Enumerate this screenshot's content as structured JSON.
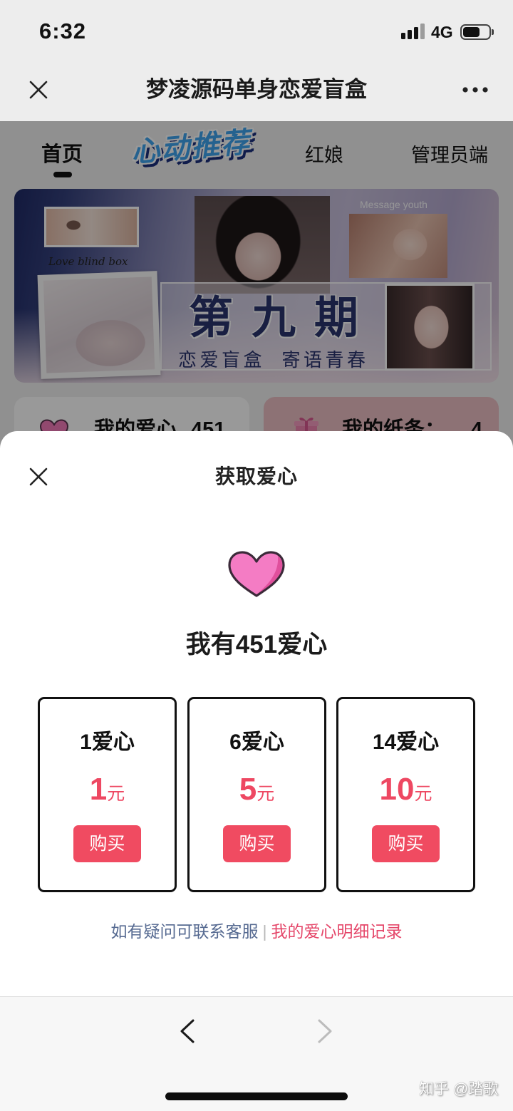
{
  "status_bar": {
    "time": "6:32",
    "network": "4G",
    "signal_bars": 3,
    "signal_max": 4,
    "battery_level": 0.65
  },
  "nav_bar": {
    "title": "梦凌源码单身恋爱盲盒",
    "close_icon": "close-icon",
    "more_icon": "more-dots-icon"
  },
  "page": {
    "tabs": [
      {
        "label": "首页",
        "active": true
      },
      {
        "label": "心动推荐",
        "active": false
      },
      {
        "label": "红娘",
        "active": false
      },
      {
        "label": "管理员端",
        "active": false
      }
    ],
    "banner": {
      "caption_left": "Love blind box",
      "caption_right": "Message youth",
      "issue": "第九期",
      "subtitle": "恋爱盲盒  寄语青春"
    },
    "stats": [
      {
        "icon": "heart-icon",
        "label": "我的爱心",
        "value": "451"
      },
      {
        "icon": "gift-icon",
        "label": "我的纸条：",
        "value": "4"
      }
    ]
  },
  "modal": {
    "title": "获取爱心",
    "close_icon": "close-icon",
    "heart_icon": "heart-icon",
    "balance": {
      "prefix": "我有",
      "value": "451",
      "suffix": "爱心"
    },
    "packages": [
      {
        "label": "1爱心",
        "price": "1",
        "currency": "元",
        "button": "购买"
      },
      {
        "label": "6爱心",
        "price": "5",
        "currency": "元",
        "button": "购买"
      },
      {
        "label": "14爱心",
        "price": "10",
        "currency": "元",
        "button": "购买"
      }
    ],
    "footer": {
      "contact": "如有疑问可联系客服",
      "separator": "|",
      "records": "我的爱心明细记录"
    }
  },
  "browser_bar": {
    "back_icon": "chevron-left-icon",
    "forward_icon": "chevron-right-icon",
    "forward_enabled": false
  },
  "watermark": "知乎 @踏歌",
  "colors": {
    "accent": "#f04b61",
    "price": "#ee4862",
    "contact_link": "#566a91",
    "records_link": "#e5476a",
    "heart": "#f47cc4"
  }
}
